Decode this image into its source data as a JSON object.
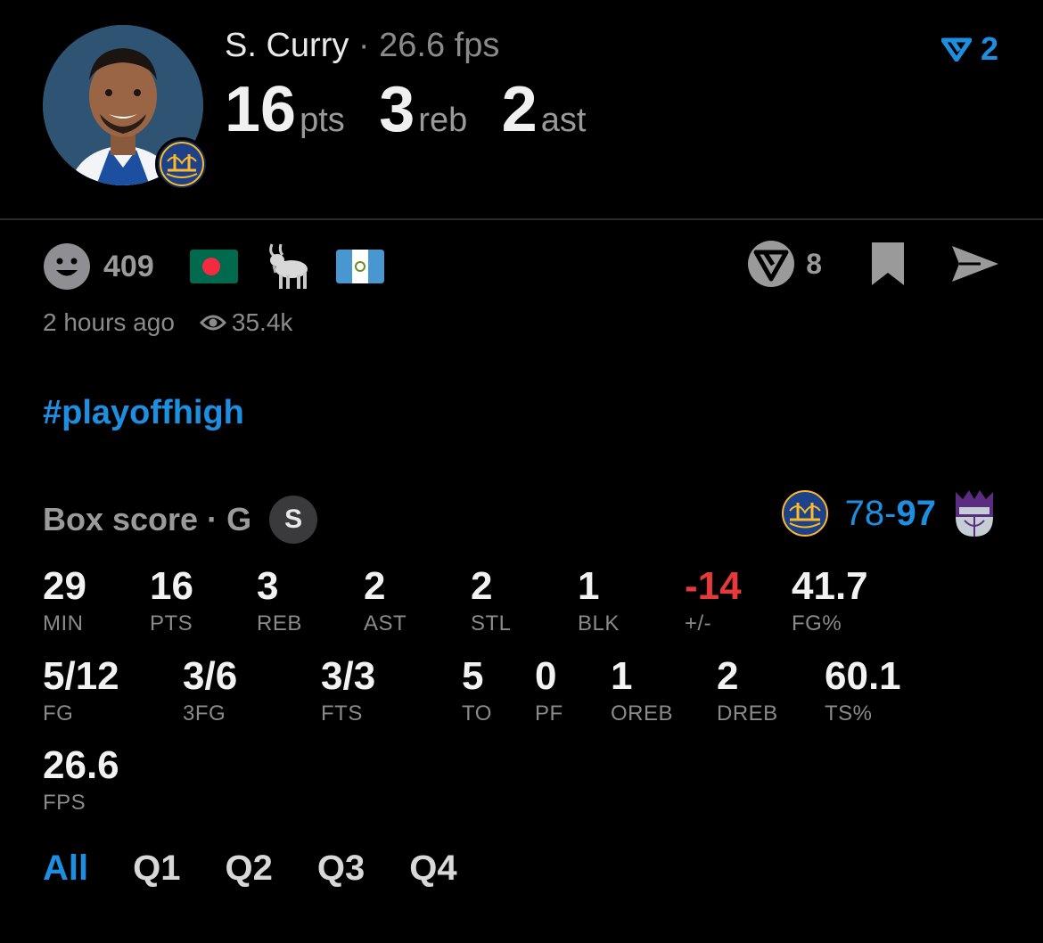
{
  "player": {
    "name": "S. Curry",
    "separator": "·",
    "fps_line": "26.6 fps",
    "pts": "16",
    "pts_unit": "pts",
    "reb": "3",
    "reb_unit": "reb",
    "ast": "2",
    "ast_unit": "ast",
    "avatar_icon": "player-headshot",
    "team_icon": "warriors-logo"
  },
  "header": {
    "vote_count": "2",
    "vote_icon": "vote-arrow-icon",
    "accent": "#1e8fe0"
  },
  "reactions": {
    "emoji_count": "409",
    "items": [
      "bangladesh-flag",
      "goat-icon",
      "guatemala-flag"
    ]
  },
  "actions": {
    "comments_count": "8"
  },
  "meta": {
    "time": "2 hours ago",
    "views": "35.4k"
  },
  "hashtag": "#playoffhigh",
  "box_score": {
    "title": "Box score · G",
    "badge": "S",
    "team_score": "78",
    "dash": "-",
    "opp_score": "97",
    "row1": [
      {
        "value": "29",
        "label": "MIN"
      },
      {
        "value": "16",
        "label": "PTS"
      },
      {
        "value": "3",
        "label": "REB"
      },
      {
        "value": "2",
        "label": "AST"
      },
      {
        "value": "2",
        "label": "STL"
      },
      {
        "value": "1",
        "label": "BLK"
      },
      {
        "value": "-14",
        "label": "+/-"
      },
      {
        "value": "41.7",
        "label": "FG%"
      }
    ],
    "row2": [
      {
        "value": "5/12",
        "label": "FG"
      },
      {
        "value": "3/6",
        "label": "3FG"
      },
      {
        "value": "3/3",
        "label": "FTS"
      },
      {
        "value": "5",
        "label": "TO"
      },
      {
        "value": "0",
        "label": "PF"
      },
      {
        "value": "1",
        "label": "OREB"
      },
      {
        "value": "2",
        "label": "DREB"
      },
      {
        "value": "60.1",
        "label": "TS%"
      }
    ],
    "row3": [
      {
        "value": "26.6",
        "label": "FPS"
      }
    ],
    "negative_color": "#e5393a"
  },
  "tabs": [
    "All",
    "Q1",
    "Q2",
    "Q3",
    "Q4"
  ]
}
